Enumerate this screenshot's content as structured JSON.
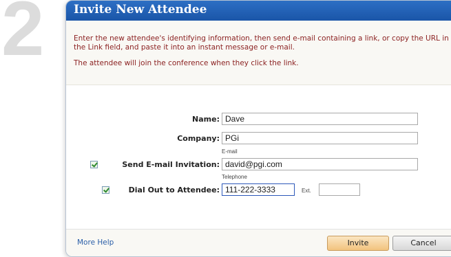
{
  "step": {
    "number": "2"
  },
  "dialog": {
    "title": "Invite New Attendee",
    "intro_paragraph_1": "Enter the new attendee's identifying information, then send e-mail containing a link, or copy the URL in the Link field, and paste it into an instant message or e-mail.",
    "intro_paragraph_2": "The attendee will join the conference when they click the link."
  },
  "form": {
    "name": {
      "label": "Name:",
      "value": "Dave"
    },
    "company": {
      "label": "Company:",
      "value": "PGi"
    },
    "email": {
      "label": "Send E-mail Invitation:",
      "field_caption": "E-mail",
      "value": "david@pgi.com",
      "checked": true
    },
    "dial_out": {
      "label": "Dial Out to Attendee:",
      "field_caption": "Telephone",
      "value": "111-222-3333",
      "ext_label": "Ext.",
      "ext_value": "",
      "checked": true
    }
  },
  "footer": {
    "help_link": "More Help",
    "invite_button": "Invite",
    "cancel_button": "Cancel"
  },
  "colors": {
    "title_bar": "#1a55a8",
    "intro_text": "#8a1f1f",
    "link": "#2a5ea8"
  }
}
